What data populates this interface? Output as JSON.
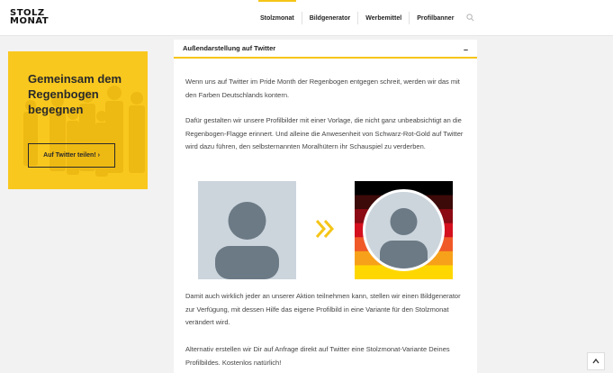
{
  "logo": {
    "line1": "STOLZ",
    "line2": "MONAT"
  },
  "nav": {
    "items": [
      {
        "label": "Stolzmonat"
      },
      {
        "label": "Bildgenerator"
      },
      {
        "label": "Werbemittel"
      },
      {
        "label": "Profilbanner"
      }
    ],
    "active": "Stolzmonat",
    "search_icon": "search-icon"
  },
  "sidebar": {
    "title": "Gemeinsam dem Regenbogen begegnen",
    "button_label": "Auf Twitter teilen! ›"
  },
  "content": {
    "header": "Außendarstellung auf Twitter",
    "collapse_symbol": "–",
    "paragraphs": [
      "Wenn uns auf Twitter im Pride Month der Regenbogen entgegen schreit, werden wir das mit den Farben Deutschlands kontern.",
      "Dafür gestalten wir unsere Profilbilder mit einer Vorlage, die nicht ganz unbeabsichtigt an die Regenbogen-Flagge erinnert. Und alleine die Anwesenheit von Schwarz-Rot-Gold auf Twitter wird dazu führen, den selbsternannten Moralhütern ihr Schauspiel zu verderben.",
      "Damit auch wirklich jeder an unserer Aktion teilnehmen kann, stellen wir einen Bildgenerator zur Verfügung, mit dessen Hilfe das eigene Profilbild in eine Variante für den Stolzmonat verändert wird.",
      "Alternativ erstellen wir Dir auf Anfrage direkt auf Twitter eine Stolzmonat-Variante Deines Profilbildes. Kostenlos natürlich!"
    ],
    "stripe_colors": [
      "#000000",
      "#3d0a0a",
      "#8b0a14",
      "#d4101e",
      "#f05a28",
      "#f7a11a",
      "#ffd700"
    ]
  },
  "colors": {
    "accent": "#f5c518",
    "card_bg": "#f9c81e",
    "avatar_bg": "#ccd5dc",
    "avatar_fg": "#6c7a86"
  }
}
